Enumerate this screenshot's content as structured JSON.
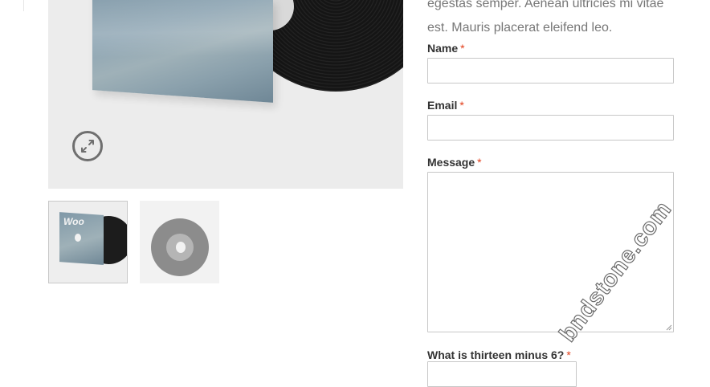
{
  "product": {
    "zoom_icon": "expand-arrows-icon",
    "thumbnails": [
      {
        "name": "album-sleeve-thumbnail",
        "text": "Woo"
      },
      {
        "name": "vinyl-disc-thumbnail"
      }
    ]
  },
  "description": {
    "line1": "egestas semper. Aenean ultricies mi vitae",
    "line2": "est. Mauris placerat eleifend leo."
  },
  "form": {
    "required_marker": "*",
    "name_label": "Name",
    "email_label": "Email",
    "message_label": "Message",
    "captcha_label": "What is thirteen minus 6?",
    "name_value": "",
    "email_value": "",
    "message_value": "",
    "captcha_value": ""
  },
  "watermark": "bndstone.com",
  "colors": {
    "required": "#e2401c",
    "label": "#333333",
    "body_text": "#777777"
  }
}
